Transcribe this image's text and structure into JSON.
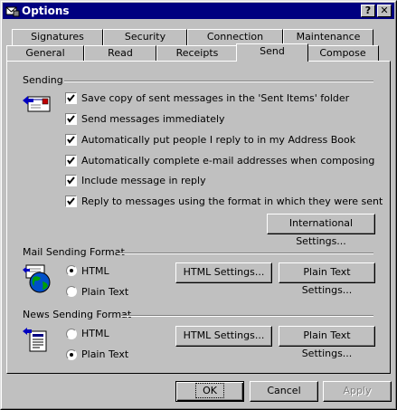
{
  "window": {
    "title": "Options",
    "help_label": "?",
    "close_label": "✕"
  },
  "tabs_back": [
    {
      "label": "Signatures"
    },
    {
      "label": "Security"
    },
    {
      "label": "Connection"
    },
    {
      "label": "Maintenance"
    }
  ],
  "tabs_front": [
    {
      "label": "General"
    },
    {
      "label": "Read"
    },
    {
      "label": "Receipts"
    },
    {
      "label": "Send",
      "active": true
    },
    {
      "label": "Compose"
    }
  ],
  "sending": {
    "heading": "Sending",
    "options": [
      {
        "label": "Save copy of sent messages in the 'Sent Items' folder",
        "checked": true
      },
      {
        "label": "Send messages immediately",
        "checked": true
      },
      {
        "label": "Automatically put people I reply to in my Address Book",
        "checked": true
      },
      {
        "label": "Automatically complete e-mail addresses when composing",
        "checked": true
      },
      {
        "label": "Include message in reply",
        "checked": true
      },
      {
        "label": "Reply to messages using the format in which they were sent",
        "checked": true
      }
    ],
    "international_button": "International Settings..."
  },
  "mail_format": {
    "heading": "Mail Sending Format",
    "html_label": "HTML",
    "plain_label": "Plain Text",
    "selected": "HTML",
    "html_settings": "HTML Settings...",
    "plain_settings": "Plain Text Settings..."
  },
  "news_format": {
    "heading": "News Sending Format",
    "html_label": "HTML",
    "plain_label": "Plain Text",
    "selected": "Plain Text",
    "html_settings": "HTML Settings...",
    "plain_settings": "Plain Text Settings..."
  },
  "footer": {
    "ok": "OK",
    "cancel": "Cancel",
    "apply": "Apply",
    "apply_enabled": false
  },
  "colors": {
    "titlebar": "#000080",
    "face": "#c0c0c0"
  }
}
